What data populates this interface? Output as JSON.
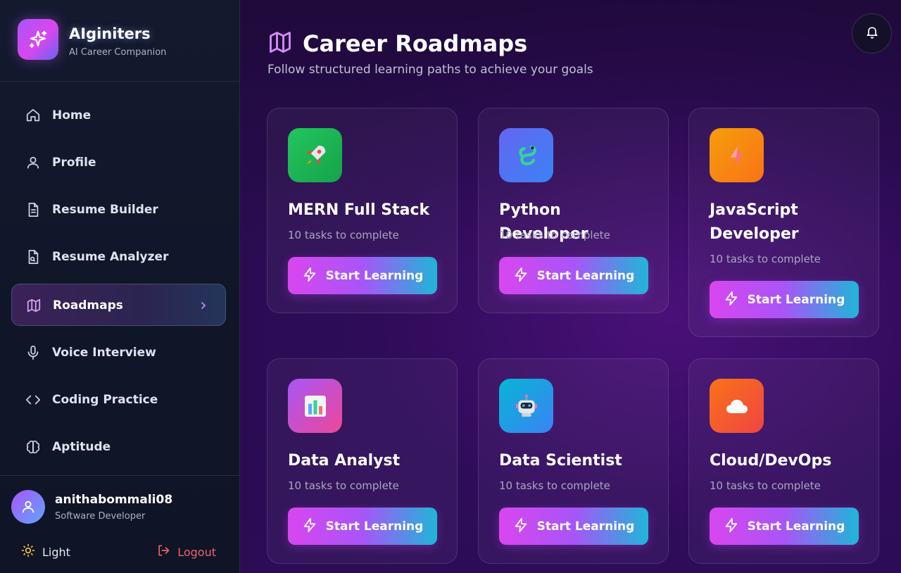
{
  "brand": {
    "name": "AIginiters",
    "subtitle": "AI Career Companion"
  },
  "nav": {
    "items": [
      {
        "label": "Home",
        "icon": "home-icon"
      },
      {
        "label": "Profile",
        "icon": "user-icon"
      },
      {
        "label": "Resume Builder",
        "icon": "file-icon"
      },
      {
        "label": "Resume Analyzer",
        "icon": "file-search-icon"
      },
      {
        "label": "Roadmaps",
        "icon": "map-icon",
        "active": true
      },
      {
        "label": "Voice Interview",
        "icon": "mic-icon"
      },
      {
        "label": "Coding Practice",
        "icon": "code-icon"
      },
      {
        "label": "Aptitude",
        "icon": "brain-icon"
      }
    ]
  },
  "user": {
    "name": "anithabommali08",
    "role": "Software Developer"
  },
  "footer": {
    "theme_label": "Light",
    "logout_label": "Logout"
  },
  "header": {
    "title": "Career Roadmaps",
    "subtitle": "Follow structured learning paths to achieve your goals"
  },
  "colors": {
    "accent_pink": "#d946ef",
    "accent_cyan": "#1fb6d8",
    "logout_red": "#f0606e"
  },
  "cards": [
    {
      "title": "MERN Full Stack",
      "tasks": "10 tasks to complete",
      "button": "Start Learning",
      "icon": "rocket-icon",
      "icon_color": "#22c55e"
    },
    {
      "title": "Python Developer",
      "tasks": "10 tasks to complete",
      "button": "Start Learning",
      "icon": "snake-icon",
      "icon_color": "#3b82f6"
    },
    {
      "title": "JavaScript Developer",
      "tasks": "10 tasks to complete",
      "button": "Start Learning",
      "icon": "lightning-icon",
      "icon_color": "#f59e0b"
    },
    {
      "title": "Data Analyst",
      "tasks": "10 tasks to complete",
      "button": "Start Learning",
      "icon": "bar-chart-icon",
      "icon_color": "#c026d3"
    },
    {
      "title": "Data Scientist",
      "tasks": "10 tasks to complete",
      "button": "Start Learning",
      "icon": "robot-icon",
      "icon_color": "#0ea5e9"
    },
    {
      "title": "Cloud/DevOps",
      "tasks": "10 tasks to complete",
      "button": "Start Learning",
      "icon": "cloud-icon",
      "icon_color": "#f97316"
    }
  ]
}
